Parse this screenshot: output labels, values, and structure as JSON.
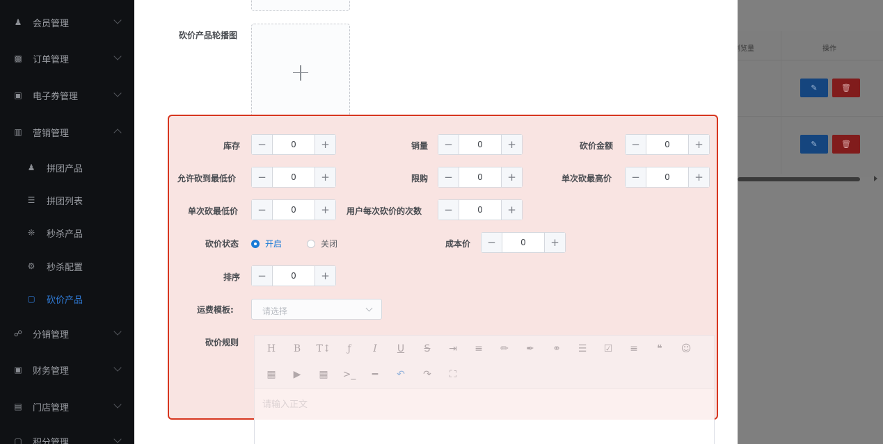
{
  "sidebar": {
    "items": [
      {
        "label": "会员管理",
        "icon": "users-icon"
      },
      {
        "label": "订单管理",
        "icon": "lock-icon"
      },
      {
        "label": "电子券管理",
        "icon": "coupon-icon"
      },
      {
        "label": "营销管理",
        "icon": "marketing-icon",
        "expanded": true
      },
      {
        "label": "拼团产品",
        "icon": "group-icon",
        "sub": true
      },
      {
        "label": "拼团列表",
        "icon": "list-icon",
        "sub": true
      },
      {
        "label": "秒杀产品",
        "icon": "flash-icon",
        "sub": true
      },
      {
        "label": "秒杀配置",
        "icon": "gear-icon",
        "sub": true
      },
      {
        "label": "砍价产品",
        "icon": "bargain-icon",
        "sub": true,
        "active": true
      },
      {
        "label": "分销管理",
        "icon": "share-icon"
      },
      {
        "label": "财务管理",
        "icon": "finance-icon"
      },
      {
        "label": "门店管理",
        "icon": "store-icon"
      },
      {
        "label": "积分管理",
        "icon": "points-icon"
      }
    ]
  },
  "table": {
    "col_views": "浏览量",
    "col_actions": "操作"
  },
  "form": {
    "carousel_label": "砍价产品轮播图",
    "stock_label": "库存",
    "stock_value": "0",
    "sales_label": "销量",
    "sales_value": "0",
    "bargain_amount_label": "砍价金额",
    "bargain_amount_value": "0",
    "min_price_label": "允许砍到最低价",
    "min_price_value": "0",
    "limit_label": "限购",
    "limit_value": "0",
    "max_per_cut_label": "单次砍最高价",
    "max_per_cut_value": "0",
    "min_per_cut_label": "单次砍最低价",
    "min_per_cut_value": "0",
    "times_label": "用户每次砍价的次数",
    "times_value": "0",
    "status_label": "砍价状态",
    "status_on": "开启",
    "status_off": "关闭",
    "cost_label": "成本价",
    "cost_value": "0",
    "sort_label": "排序",
    "sort_value": "0",
    "shipping_label": "运费模板:",
    "shipping_placeholder": "请选择",
    "rules_label": "砍价规则",
    "editor_placeholder": "请输入正文"
  },
  "stepper": {
    "minus": "−",
    "plus": "+"
  },
  "colors": {
    "accent": "#1b7bd6",
    "highlight_border": "#d7361f",
    "highlight_fill": "#f9e4e2"
  }
}
